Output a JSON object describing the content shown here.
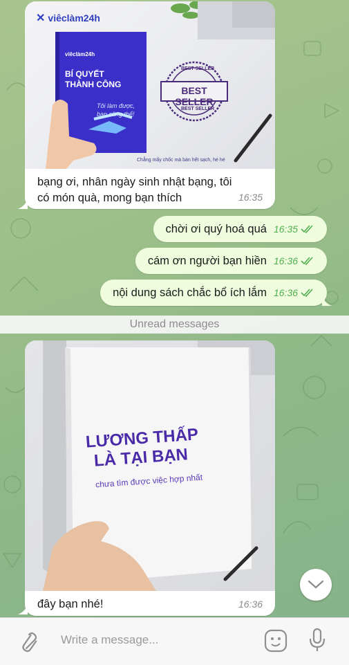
{
  "messages": {
    "incoming1": {
      "brand": "viêclàm24h",
      "book_brand": "viêclàm24h",
      "book_title_line1": "BÍ QUYẾT",
      "book_title_line2": "THÀNH CÔNG",
      "book_tagline_line1": "Tôi làm được,",
      "book_tagline_line2": "bạn cũng thế!",
      "stamp_top": "BEST SELLER",
      "stamp_main": "BEST SELLER",
      "stamp_bottom": "BEST SELLER",
      "image_footer": "Chẳng mấy chốc mà bán hết sạch, hé hé",
      "text_line1": "bạng ơi, nhân ngày sinh nhật bạng, tôi",
      "text_line2": "có món quà, mong bạn thích",
      "time": "16:35"
    },
    "outgoing": [
      {
        "text": "chời ơi quý hoá quá",
        "time": "16:35"
      },
      {
        "text": "cám ơn người bạn hiền",
        "time": "16:36"
      },
      {
        "text": "nội dung sách chắc bổ ích lắm",
        "time": "16:36"
      }
    ],
    "incoming2": {
      "book_line1": "LƯƠNG THẤP",
      "book_line2": "LÀ TẠI BẠN",
      "book_sub": "chưa tìm được việc hợp nhất",
      "text": "đây bạn nhé!",
      "time": "16:36"
    }
  },
  "unread_label": "Unread messages",
  "composer": {
    "placeholder": "Write a message...",
    "icons": [
      "paperclip-icon",
      "sticker-icon",
      "microphone-icon"
    ]
  },
  "colors": {
    "incoming_bubble": "#ffffff",
    "outgoing_bubble": "#effdde",
    "time_green": "#4fae4e",
    "book_blue": "#3b2fc9",
    "book_purple": "#4a2aa8"
  }
}
